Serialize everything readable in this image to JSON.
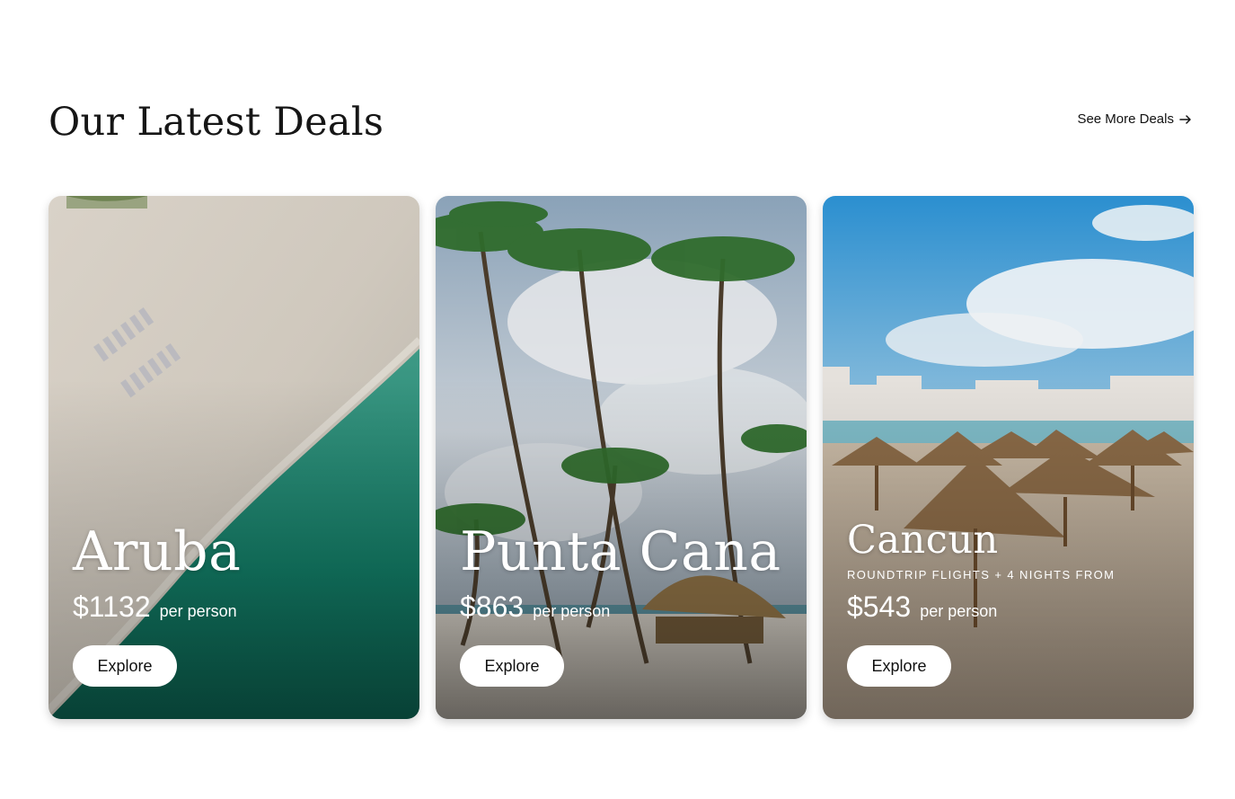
{
  "header": {
    "title": "Our Latest Deals",
    "see_more_label": "See More Deals",
    "see_more_icon": "arrow-right-icon"
  },
  "deals": [
    {
      "name": "Aruba",
      "subtitle": "",
      "price": "$1132",
      "per_person": "per person",
      "button_label": "Explore",
      "image": "aerial-beach-turquoise-water"
    },
    {
      "name": "Punta Cana",
      "subtitle": "",
      "price": "$863",
      "per_person": "per person",
      "button_label": "Explore",
      "image": "palm-trees-beach-hut"
    },
    {
      "name": "Cancun",
      "subtitle": "Roundtrip flights + 4 nights from",
      "price": "$543",
      "per_person": "per person",
      "button_label": "Explore",
      "image": "beach-straw-umbrellas-hotels"
    }
  ],
  "colors": {
    "background": "#ffffff",
    "text_dark": "#161616",
    "button_bg": "#ffffff",
    "card_text": "#ffffff"
  }
}
